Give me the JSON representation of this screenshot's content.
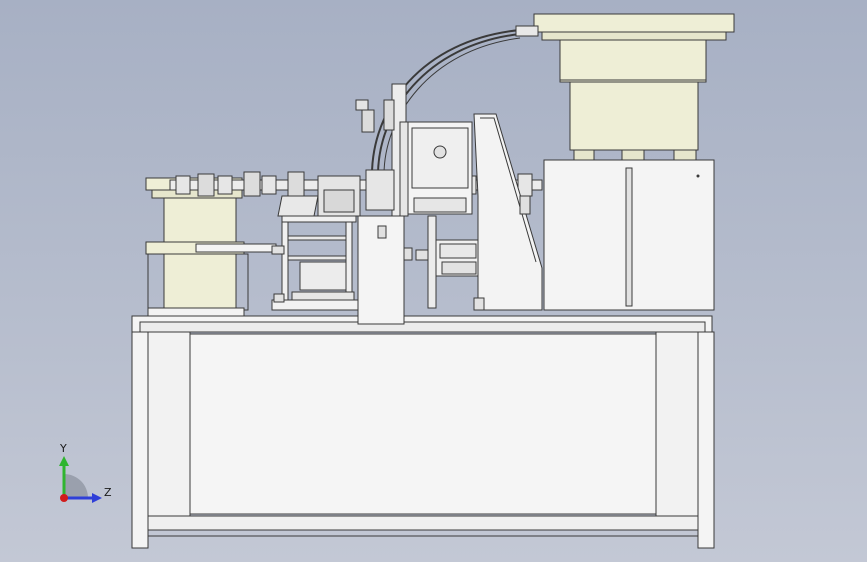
{
  "viewport": {
    "background_top": "#a7b0c4",
    "background_bottom": "#c3c8d5"
  },
  "model": {
    "line_color": "#3a3a3a",
    "fill_color": "#f2f2ee",
    "bowl_fill": "#eeeed6",
    "panel_fill": "#f4f4f4"
  },
  "triad": {
    "y_label": "Y",
    "z_label": "Z",
    "y_color": "#2fb52f",
    "z_color": "#2f3fd8",
    "x_color": "#d01c1c"
  }
}
